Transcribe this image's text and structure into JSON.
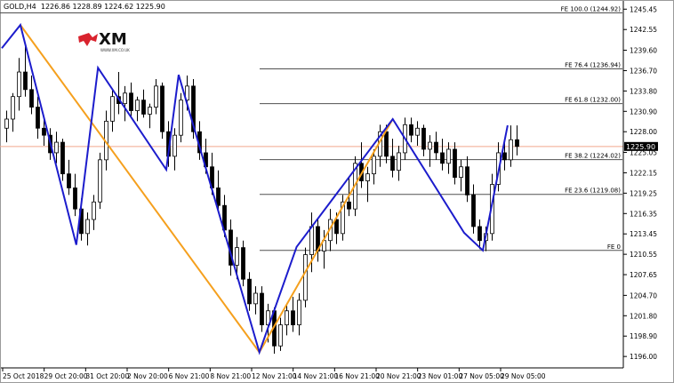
{
  "header": {
    "symbol": "GOLD,H4",
    "ohlc": "1226.86 1228.89 1224.62 1225.90"
  },
  "logo": {
    "brand": "XM",
    "tagline": "WWW.XM.CO.UK",
    "colors": {
      "mark": "#d9232e",
      "text": "#111111"
    }
  },
  "colors": {
    "candle": "#000000",
    "zigzag_blue": "#1c1ccc",
    "zigzag_orange": "#f5a01e",
    "level_line": "#505050",
    "current_price_line": "#f2a98c",
    "price_box": "#000000"
  },
  "chart_data": {
    "type": "candlestick",
    "symbol": "GOLD,H4",
    "ylim": [
      1194.5,
      1246.5
    ],
    "y_ticks": [
      "1245.45",
      "1242.55",
      "1239.60",
      "1236.70",
      "1233.80",
      "1230.90",
      "1228.00",
      "1225.05",
      "1222.15",
      "1219.25",
      "1216.35",
      "1213.45",
      "1210.55",
      "1207.65",
      "1204.70",
      "1201.80",
      "1198.90",
      "1196.00"
    ],
    "x_tick_labels": [
      "25 Oct 2018",
      "29 Oct 20:00",
      "31 Oct 20:00",
      "2 Nov 20:00",
      "6 Nov 21:00",
      "8 Nov 21:00",
      "12 Nov 21:00",
      "14 Nov 21:00",
      "16 Nov 21:00",
      "20 Nov 21:00",
      "23 Nov 01:00",
      "27 Nov 05:00",
      "29 Nov 05:00"
    ],
    "current_price": 1225.9,
    "fib_levels": [
      {
        "label": "FE 100.0  (1244.92)",
        "value": 1244.92
      },
      {
        "label": "FE 76.4  (1236.94)",
        "value": 1236.94
      },
      {
        "label": "FE 61.8  (1232.00)",
        "value": 1232.0
      },
      {
        "label": "FE 38.2  (1224.02)",
        "value": 1224.02
      },
      {
        "label": "FE 23.6  (1219.08)",
        "value": 1219.08
      },
      {
        "label": "FE 0",
        "value": 1211.1
      }
    ],
    "zigzag_blue": [
      {
        "x": 0.0,
        "y": 1239.9
      },
      {
        "x": 0.03,
        "y": 1243.2
      },
      {
        "x": 0.12,
        "y": 1211.9
      },
      {
        "x": 0.155,
        "y": 1237.1
      },
      {
        "x": 0.265,
        "y": 1222.6
      },
      {
        "x": 0.285,
        "y": 1236.1
      },
      {
        "x": 0.415,
        "y": 1196.6
      },
      {
        "x": 0.475,
        "y": 1211.6
      },
      {
        "x": 0.63,
        "y": 1229.8
      },
      {
        "x": 0.745,
        "y": 1213.6
      },
      {
        "x": 0.775,
        "y": 1211.1
      },
      {
        "x": 0.815,
        "y": 1228.9
      }
    ],
    "zigzag_orange": [
      {
        "x": 0.03,
        "y": 1243.2
      },
      {
        "x": 0.415,
        "y": 1196.6
      },
      {
        "x": 0.63,
        "y": 1229.8
      }
    ],
    "candles": [
      {
        "o": 1228.5,
        "h": 1231.0,
        "l": 1226.5,
        "c": 1229.8
      },
      {
        "o": 1229.8,
        "h": 1233.5,
        "l": 1228.0,
        "c": 1233.0
      },
      {
        "o": 1233.0,
        "h": 1238.5,
        "l": 1231.0,
        "c": 1236.5
      },
      {
        "o": 1236.5,
        "h": 1240.5,
        "l": 1233.0,
        "c": 1234.0
      },
      {
        "o": 1234.0,
        "h": 1236.0,
        "l": 1230.5,
        "c": 1231.5
      },
      {
        "o": 1231.5,
        "h": 1233.0,
        "l": 1227.0,
        "c": 1228.5
      },
      {
        "o": 1228.5,
        "h": 1230.0,
        "l": 1226.0,
        "c": 1227.5
      },
      {
        "o": 1227.5,
        "h": 1228.5,
        "l": 1224.0,
        "c": 1225.0
      },
      {
        "o": 1225.0,
        "h": 1228.0,
        "l": 1223.5,
        "c": 1226.5
      },
      {
        "o": 1226.5,
        "h": 1227.0,
        "l": 1221.0,
        "c": 1222.0
      },
      {
        "o": 1222.0,
        "h": 1224.0,
        "l": 1219.0,
        "c": 1220.0
      },
      {
        "o": 1220.0,
        "h": 1222.0,
        "l": 1216.0,
        "c": 1217.0
      },
      {
        "o": 1217.0,
        "h": 1218.5,
        "l": 1212.5,
        "c": 1213.5
      },
      {
        "o": 1213.5,
        "h": 1216.5,
        "l": 1211.8,
        "c": 1215.5
      },
      {
        "o": 1215.5,
        "h": 1219.0,
        "l": 1214.0,
        "c": 1218.0
      },
      {
        "o": 1218.0,
        "h": 1225.0,
        "l": 1217.0,
        "c": 1224.0
      },
      {
        "o": 1224.0,
        "h": 1231.0,
        "l": 1222.5,
        "c": 1229.5
      },
      {
        "o": 1229.5,
        "h": 1234.0,
        "l": 1228.0,
        "c": 1233.0
      },
      {
        "o": 1233.0,
        "h": 1236.5,
        "l": 1230.5,
        "c": 1232.0
      },
      {
        "o": 1232.0,
        "h": 1234.5,
        "l": 1229.5,
        "c": 1233.5
      },
      {
        "o": 1233.5,
        "h": 1235.0,
        "l": 1230.0,
        "c": 1231.0
      },
      {
        "o": 1231.0,
        "h": 1233.0,
        "l": 1229.5,
        "c": 1232.5
      },
      {
        "o": 1232.5,
        "h": 1234.0,
        "l": 1230.0,
        "c": 1230.5
      },
      {
        "o": 1230.5,
        "h": 1232.0,
        "l": 1228.5,
        "c": 1231.5
      },
      {
        "o": 1231.5,
        "h": 1235.5,
        "l": 1230.5,
        "c": 1234.5
      },
      {
        "o": 1234.5,
        "h": 1235.0,
        "l": 1227.0,
        "c": 1228.0
      },
      {
        "o": 1228.0,
        "h": 1229.5,
        "l": 1223.0,
        "c": 1224.5
      },
      {
        "o": 1224.5,
        "h": 1228.5,
        "l": 1222.5,
        "c": 1227.5
      },
      {
        "o": 1227.5,
        "h": 1233.5,
        "l": 1226.5,
        "c": 1232.5
      },
      {
        "o": 1232.5,
        "h": 1236.0,
        "l": 1231.0,
        "c": 1234.5
      },
      {
        "o": 1234.5,
        "h": 1235.5,
        "l": 1227.0,
        "c": 1228.0
      },
      {
        "o": 1228.0,
        "h": 1229.5,
        "l": 1224.0,
        "c": 1225.0
      },
      {
        "o": 1225.0,
        "h": 1227.0,
        "l": 1222.0,
        "c": 1223.0
      },
      {
        "o": 1223.0,
        "h": 1225.0,
        "l": 1219.0,
        "c": 1220.0
      },
      {
        "o": 1220.0,
        "h": 1222.5,
        "l": 1216.5,
        "c": 1217.5
      },
      {
        "o": 1217.5,
        "h": 1219.0,
        "l": 1213.0,
        "c": 1214.0
      },
      {
        "o": 1214.0,
        "h": 1215.5,
        "l": 1207.5,
        "c": 1209.0
      },
      {
        "o": 1209.0,
        "h": 1213.0,
        "l": 1207.0,
        "c": 1211.5
      },
      {
        "o": 1211.5,
        "h": 1212.5,
        "l": 1206.0,
        "c": 1207.0
      },
      {
        "o": 1207.0,
        "h": 1208.0,
        "l": 1202.5,
        "c": 1203.5
      },
      {
        "o": 1203.5,
        "h": 1206.0,
        "l": 1202.0,
        "c": 1205.0
      },
      {
        "o": 1205.0,
        "h": 1206.0,
        "l": 1199.5,
        "c": 1200.5
      },
      {
        "o": 1200.5,
        "h": 1203.5,
        "l": 1198.0,
        "c": 1202.5
      },
      {
        "o": 1202.5,
        "h": 1203.0,
        "l": 1196.4,
        "c": 1197.5
      },
      {
        "o": 1197.5,
        "h": 1201.5,
        "l": 1196.8,
        "c": 1200.5
      },
      {
        "o": 1200.5,
        "h": 1203.5,
        "l": 1199.0,
        "c": 1202.5
      },
      {
        "o": 1202.5,
        "h": 1204.5,
        "l": 1199.5,
        "c": 1200.5
      },
      {
        "o": 1200.5,
        "h": 1205.0,
        "l": 1199.0,
        "c": 1204.0
      },
      {
        "o": 1204.0,
        "h": 1211.5,
        "l": 1203.0,
        "c": 1210.5
      },
      {
        "o": 1210.5,
        "h": 1216.5,
        "l": 1208.0,
        "c": 1214.5
      },
      {
        "o": 1214.5,
        "h": 1215.5,
        "l": 1209.5,
        "c": 1211.0
      },
      {
        "o": 1211.0,
        "h": 1214.0,
        "l": 1208.5,
        "c": 1212.5
      },
      {
        "o": 1212.5,
        "h": 1217.0,
        "l": 1211.0,
        "c": 1215.5
      },
      {
        "o": 1215.5,
        "h": 1216.5,
        "l": 1212.0,
        "c": 1213.5
      },
      {
        "o": 1213.5,
        "h": 1219.0,
        "l": 1212.5,
        "c": 1218.0
      },
      {
        "o": 1218.0,
        "h": 1221.5,
        "l": 1216.0,
        "c": 1217.0
      },
      {
        "o": 1217.0,
        "h": 1224.5,
        "l": 1216.0,
        "c": 1223.5
      },
      {
        "o": 1223.5,
        "h": 1226.5,
        "l": 1220.0,
        "c": 1221.0
      },
      {
        "o": 1221.0,
        "h": 1223.0,
        "l": 1218.0,
        "c": 1222.0
      },
      {
        "o": 1222.0,
        "h": 1225.5,
        "l": 1220.5,
        "c": 1224.5
      },
      {
        "o": 1224.5,
        "h": 1229.0,
        "l": 1223.0,
        "c": 1228.0
      },
      {
        "o": 1228.0,
        "h": 1229.0,
        "l": 1223.5,
        "c": 1224.5
      },
      {
        "o": 1224.5,
        "h": 1227.0,
        "l": 1221.5,
        "c": 1222.5
      },
      {
        "o": 1222.5,
        "h": 1226.0,
        "l": 1221.0,
        "c": 1225.0
      },
      {
        "o": 1225.0,
        "h": 1230.0,
        "l": 1224.0,
        "c": 1229.0
      },
      {
        "o": 1229.0,
        "h": 1230.0,
        "l": 1226.5,
        "c": 1227.5
      },
      {
        "o": 1227.5,
        "h": 1229.5,
        "l": 1226.0,
        "c": 1228.5
      },
      {
        "o": 1228.5,
        "h": 1229.0,
        "l": 1224.5,
        "c": 1225.5
      },
      {
        "o": 1225.5,
        "h": 1227.5,
        "l": 1223.0,
        "c": 1226.5
      },
      {
        "o": 1226.5,
        "h": 1228.0,
        "l": 1224.0,
        "c": 1225.0
      },
      {
        "o": 1225.0,
        "h": 1227.0,
        "l": 1222.5,
        "c": 1223.5
      },
      {
        "o": 1223.5,
        "h": 1226.5,
        "l": 1222.0,
        "c": 1225.5
      },
      {
        "o": 1225.5,
        "h": 1226.5,
        "l": 1220.5,
        "c": 1221.5
      },
      {
        "o": 1221.5,
        "h": 1224.0,
        "l": 1219.5,
        "c": 1223.0
      },
      {
        "o": 1223.0,
        "h": 1224.5,
        "l": 1218.0,
        "c": 1219.0
      },
      {
        "o": 1219.0,
        "h": 1220.5,
        "l": 1213.5,
        "c": 1214.5
      },
      {
        "o": 1214.5,
        "h": 1215.5,
        "l": 1211.3,
        "c": 1212.5
      },
      {
        "o": 1212.5,
        "h": 1214.5,
        "l": 1211.0,
        "c": 1213.5
      },
      {
        "o": 1213.5,
        "h": 1222.0,
        "l": 1212.5,
        "c": 1220.5
      },
      {
        "o": 1220.5,
        "h": 1226.5,
        "l": 1219.5,
        "c": 1225.0
      },
      {
        "o": 1225.0,
        "h": 1227.0,
        "l": 1222.5,
        "c": 1224.0
      },
      {
        "o": 1224.0,
        "h": 1228.89,
        "l": 1223.0,
        "c": 1226.86
      },
      {
        "o": 1226.86,
        "h": 1228.89,
        "l": 1224.62,
        "c": 1225.9
      }
    ]
  }
}
